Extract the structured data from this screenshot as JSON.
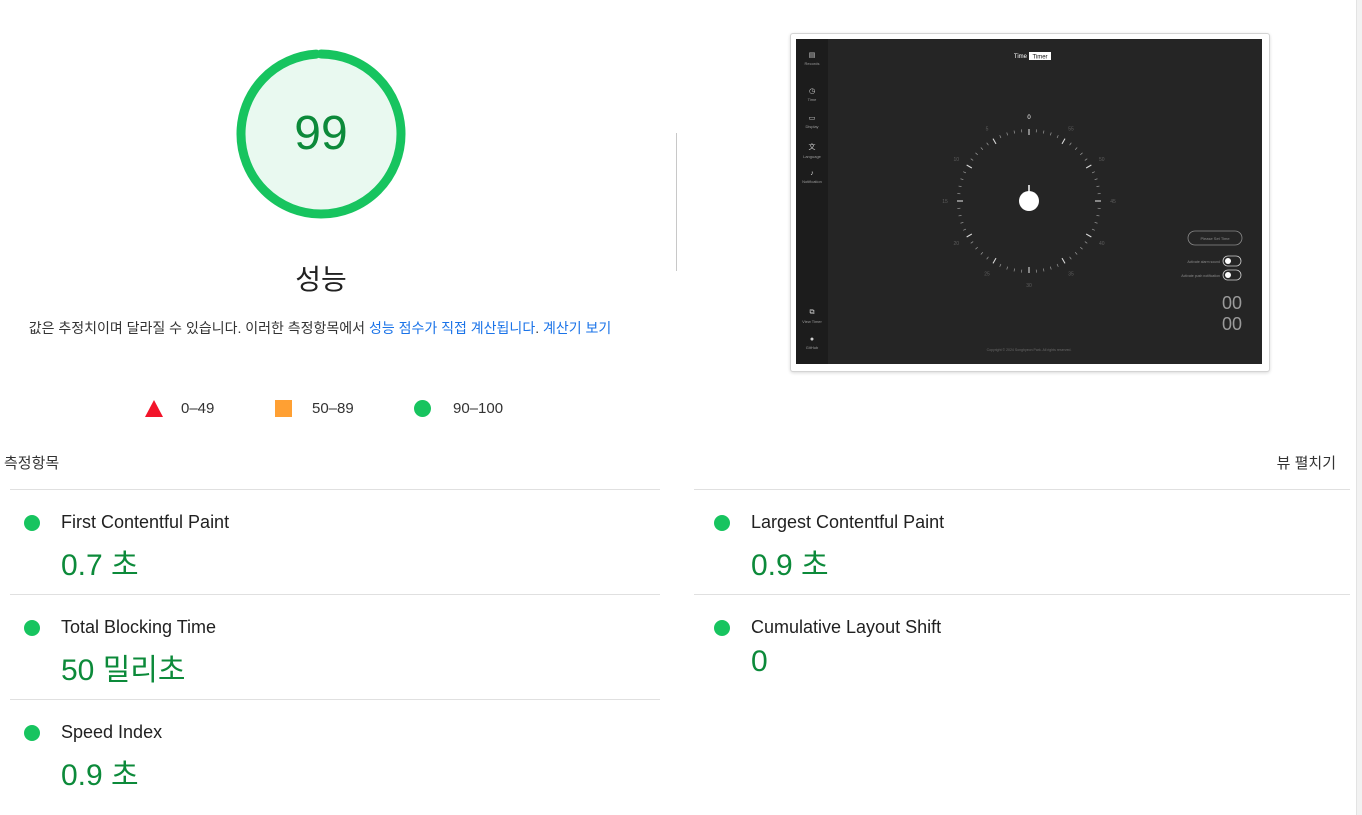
{
  "score": {
    "value": "99",
    "fraction": 0.99,
    "title": "성능",
    "description_text": "값은 추정치이며 달라질 수 있습니다. 이러한 측정항목에서 ",
    "description_link1": "성능 점수가 직접 계산됩니다",
    "description_sep": ". ",
    "description_link2": "계산기 보기",
    "ring_color": "#17c45f",
    "fill_color": "#e9f9f0",
    "text_color": "#0c8a3a"
  },
  "legend": [
    {
      "shape": "triangle",
      "label": "0–49",
      "color": "#f2142a"
    },
    {
      "shape": "square",
      "label": "50–89",
      "color": "#ffa033"
    },
    {
      "shape": "circle",
      "label": "90–100",
      "color": "#17c45f"
    }
  ],
  "thumbnail": {
    "header_left": "Time",
    "header_right": "Timer",
    "sidebar": [
      {
        "icon": "records-icon",
        "label": "Records"
      },
      {
        "icon": "clock-icon",
        "label": "Time"
      },
      {
        "icon": "display-icon",
        "label": "Display"
      },
      {
        "icon": "language-icon",
        "label": "Language"
      },
      {
        "icon": "bell-icon",
        "label": "Notification"
      },
      {
        "icon": "external-link-icon",
        "label": "View Timer"
      },
      {
        "icon": "github-icon",
        "label": "GitHub"
      }
    ],
    "dial_numbers": [
      "0",
      "5",
      "10",
      "15",
      "20",
      "25",
      "30",
      "35",
      "40",
      "45",
      "50",
      "55"
    ],
    "button_label": "Please Set Time",
    "toggle1_label": "Activate alarm sound",
    "toggle2_label": "Activate push notification",
    "digits_top": "00",
    "digits_bottom": "00",
    "footer": "Copyright © 2024 Songhyeon Park. All rights reserved."
  },
  "metrics_header": "측정항목",
  "expand_view": "뷰 펼치기",
  "metrics": {
    "fcp": {
      "label": "First Contentful Paint",
      "value": "0.7 초"
    },
    "lcp": {
      "label": "Largest Contentful Paint",
      "value": "0.9 초"
    },
    "tbt": {
      "label": "Total Blocking Time",
      "value": "50 밀리초"
    },
    "cls": {
      "label": "Cumulative Layout Shift",
      "value": "0"
    },
    "si": {
      "label": "Speed Index",
      "value": "0.9 초"
    }
  }
}
